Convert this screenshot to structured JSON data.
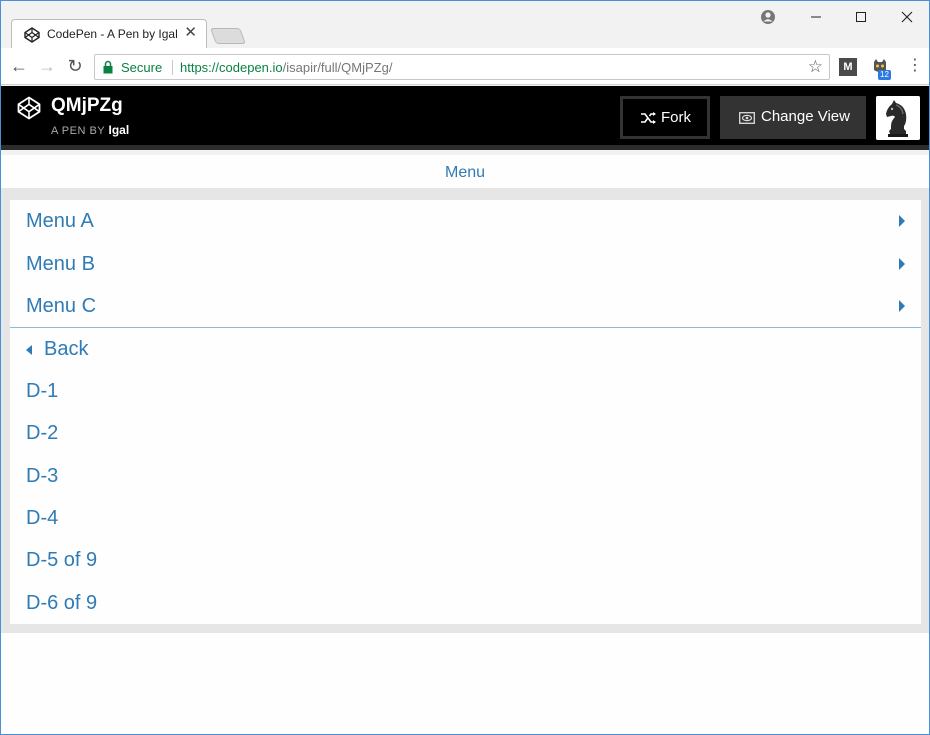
{
  "browser": {
    "tab_title": "CodePen - A Pen by Igal",
    "secure_label": "Secure",
    "url_host": "https://codepen.io",
    "url_path": "/isapir/full/QMjPZg/",
    "extension_badge": "12"
  },
  "codepen": {
    "pen_title": "QMjPZg",
    "pen_by_label": "A PEN BY",
    "author": "Igal",
    "fork_label": "Fork",
    "change_view_label": "Change View"
  },
  "page": {
    "menu_title": "Menu",
    "menu_items": [
      {
        "label": "Menu A"
      },
      {
        "label": "Menu B"
      },
      {
        "label": "Menu C"
      }
    ],
    "back_label": "Back",
    "sub_items": [
      {
        "label": "D-1"
      },
      {
        "label": "D-2"
      },
      {
        "label": "D-3"
      },
      {
        "label": "D-4"
      },
      {
        "label": "D-5 of 9"
      },
      {
        "label": "D-6 of 9"
      }
    ]
  },
  "colors": {
    "link": "#2f7bb5",
    "secure_green": "#0b8043",
    "header_bg": "#000000"
  },
  "icons": {
    "tab_favicon": "codepen-icon",
    "fork": "fork-icon",
    "change_view": "eye-icon",
    "avatar": "chess-knight-avatar"
  }
}
